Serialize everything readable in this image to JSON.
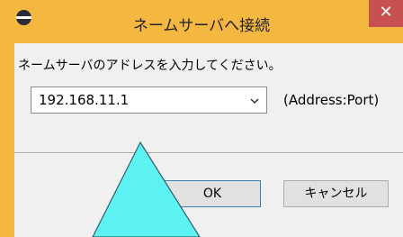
{
  "window": {
    "title": "ネームサーバへ接続",
    "close_label": "✕",
    "accent_color": "#f4b740",
    "close_color": "#c75050"
  },
  "dialog": {
    "prompt": "ネームサーバのアドレスを入力してください。",
    "address_value": "192.168.11.1",
    "address_hint": "(Address:Port)",
    "ok_label": "OK",
    "cancel_label": "キャンセル"
  },
  "overlay": {
    "marker_color": "#5ef3f3",
    "shape": "triangle-pointer"
  }
}
